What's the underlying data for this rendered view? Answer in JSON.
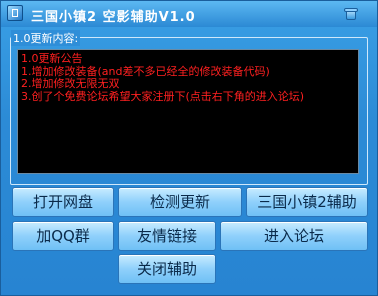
{
  "window": {
    "title": "三国小镇2 空影辅助V1.0"
  },
  "update_group": {
    "label": "1.0更新内容:",
    "lines": [
      "1.0更新公告",
      "1.增加修改装备(and差不多已经全的修改装备代码)",
      "2.增加修改无限无双",
      "3.创了个免费论坛希望大家注册下(点击右下角的进入论坛)"
    ]
  },
  "buttons": {
    "open_disk": "打开网盘",
    "check_update": "检测更新",
    "sanguo_helper": "三国小镇2辅助",
    "join_qq": "加QQ群",
    "friend_links": "友情链接",
    "enter_forum": "进入论坛",
    "close_helper": "关闭辅助"
  },
  "colors": {
    "window_bg": "#2f8fd8",
    "log_text": "#ff2020",
    "log_bg": "#000000"
  }
}
